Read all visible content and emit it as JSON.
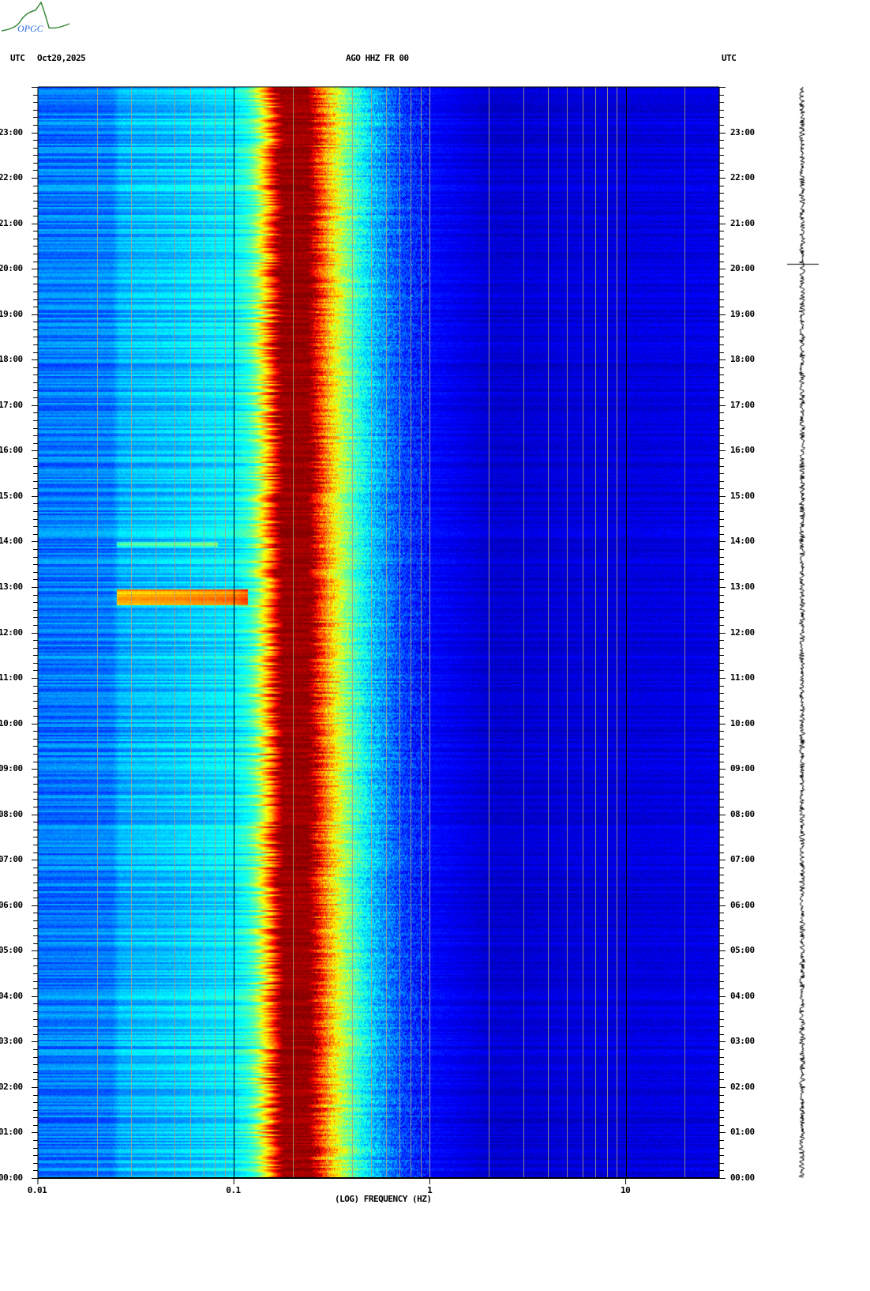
{
  "header": {
    "logo_text": "OPGC",
    "left_label": "UTC",
    "date": "Oct20,2025",
    "station": "AGO HHZ FR 00",
    "right_label": "UTC"
  },
  "chart_data": {
    "type": "heatmap",
    "title": "AGO HHZ FR 00",
    "date": "Oct20,2025",
    "xlabel": "(LOG) FREQUENCY (HZ)",
    "x_scale": "log",
    "xlim": [
      0.01,
      30
    ],
    "x_ticks": [
      {
        "value": 0.01,
        "label": "0.01"
      },
      {
        "value": 0.1,
        "label": "0.1"
      },
      {
        "value": 1,
        "label": "1"
      },
      {
        "value": 10,
        "label": "10"
      }
    ],
    "ylabel": "UTC",
    "ylim_hours": [
      0,
      24
    ],
    "y_ticks": [
      "00:00",
      "01:00",
      "02:00",
      "03:00",
      "04:00",
      "05:00",
      "06:00",
      "07:00",
      "08:00",
      "09:00",
      "10:00",
      "11:00",
      "12:00",
      "13:00",
      "14:00",
      "15:00",
      "16:00",
      "17:00",
      "18:00",
      "19:00",
      "20:00",
      "21:00",
      "22:00",
      "23:00"
    ],
    "colormap": "jet",
    "power_profile": {
      "freq_hz": [
        0.01,
        0.024,
        0.026,
        0.05,
        0.1,
        0.12,
        0.13,
        0.15,
        0.17,
        0.25,
        0.28,
        0.33,
        0.4,
        0.5,
        0.7,
        1,
        2,
        30
      ],
      "level": [
        0.24,
        0.25,
        0.3,
        0.32,
        0.36,
        0.42,
        0.5,
        0.72,
        0.97,
        0.97,
        0.8,
        0.62,
        0.46,
        0.33,
        0.2,
        0.13,
        0.08,
        0.1
      ]
    },
    "events": [
      {
        "start_hour": 12.6,
        "end_hour": 12.95,
        "max_freq_hz": 0.1,
        "boost": 0.4
      },
      {
        "start_hour": 13.9,
        "end_hour": 14.0,
        "max_freq_hz": 0.07,
        "boost": 0.15
      }
    ],
    "trace_marker_hour": 20.1
  }
}
